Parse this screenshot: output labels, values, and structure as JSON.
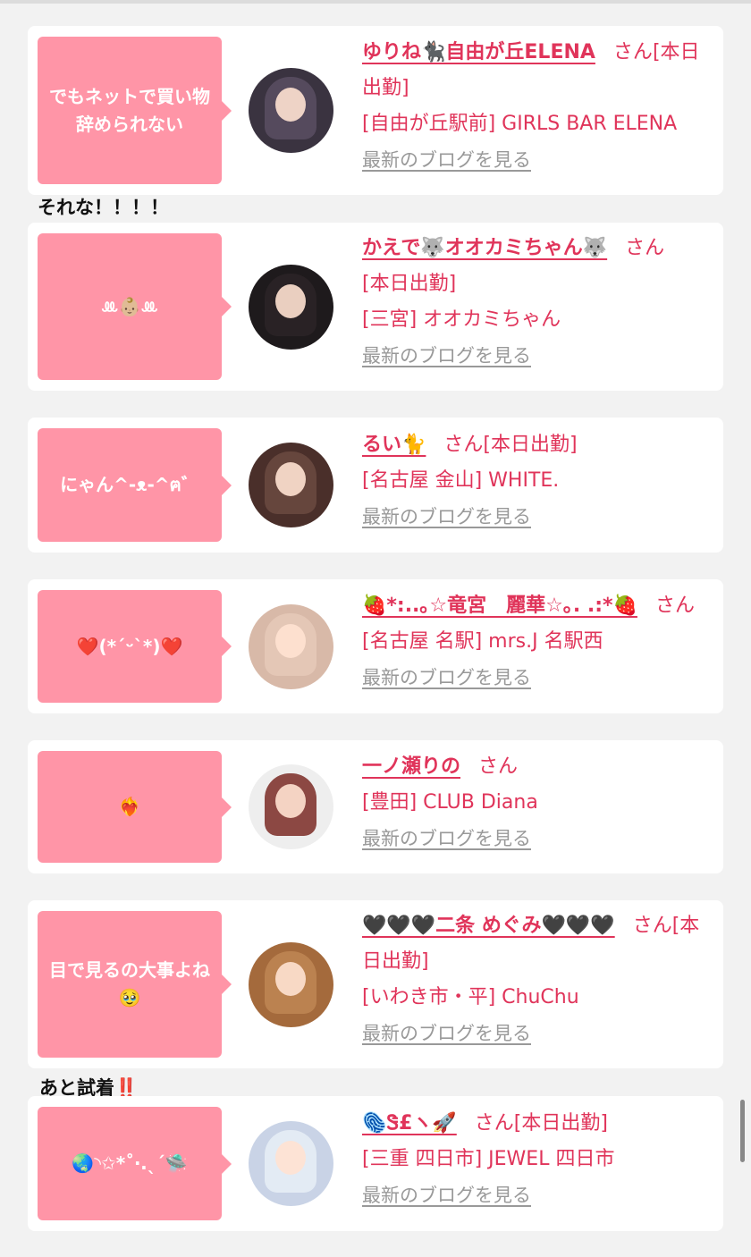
{
  "entries": [
    {
      "bubble": "でもネットで買い物辞められない",
      "name": "ゆりね🐈‍⬛自由が丘ELENA",
      "san": "さん",
      "status": "[本日出勤]",
      "shop": "[自由が丘駅前] GIRLS BAR ELENA",
      "blog": "最新のブログを見る",
      "avatar_colors": [
        "#3a3340",
        "#f3d8e4"
      ]
    },
    {
      "bubble": "ꔛ👶🏼ꔛ",
      "name": "かえで🐺オオカミちゃん🐺",
      "san": "さん",
      "status": "[本日出勤]",
      "shop": "[三宮] オオカミちゃん",
      "blog": "最新のブログを見る",
      "avatar_colors": [
        "#1e1a1c",
        "#e9d6cc"
      ]
    },
    {
      "bubble": "にゃん^-ᴥ-^ฅ゛",
      "name": "るい🐈",
      "san": "さん",
      "status": "[本日出勤]",
      "shop": "[名古屋 金山] WHITE.",
      "blog": "最新のブログを見る",
      "avatar_colors": [
        "#4a2f2a",
        "#f0d3d3"
      ]
    },
    {
      "bubble": "❤️(*´ᵕ`*)❤️",
      "name": "🍓*:..｡☆竜宮　麗華☆｡. .:*🍓",
      "san": "さん",
      "status": "",
      "shop": "[名古屋 名駅] mrs.J 名駅西",
      "blog": "最新のブログを見る",
      "avatar_colors": [
        "#d8b9a8",
        "#f6e4dc"
      ]
    },
    {
      "bubble": "❤️‍🔥",
      "name": "一ノ瀬りの",
      "san": "さん",
      "status": "",
      "shop": "[豊田] CLUB Diana",
      "blog": "最新のブログを見る",
      "avatar_colors": [
        "#7a2a24",
        "#eeeeee"
      ]
    },
    {
      "bubble": "目で見るの大事よね🥹",
      "name": "🖤🖤🖤二条 めぐみ🖤🖤🖤",
      "san": "さん",
      "status": "[本日出勤]",
      "shop": "[いわき市・平] ChuChu",
      "blog": "最新のブログを見る",
      "avatar_colors": [
        "#a46a3c",
        "#e7d4c8"
      ]
    },
    {
      "bubble": "🌏◝✩*˚‧.ˎˊ🛸",
      "name": "🫆Ꮥ£ヽ🚀",
      "san": "さん",
      "status": "[本日出勤]",
      "shop": "[三重 四日市] JEWEL 四日市",
      "blog": "最新のブログを見る",
      "avatar_colors": [
        "#c9d3e6",
        "#f7eef2"
      ]
    }
  ],
  "comments": {
    "first": "それな！！！！",
    "second": "あと試着",
    "second_mark": "‼️"
  }
}
